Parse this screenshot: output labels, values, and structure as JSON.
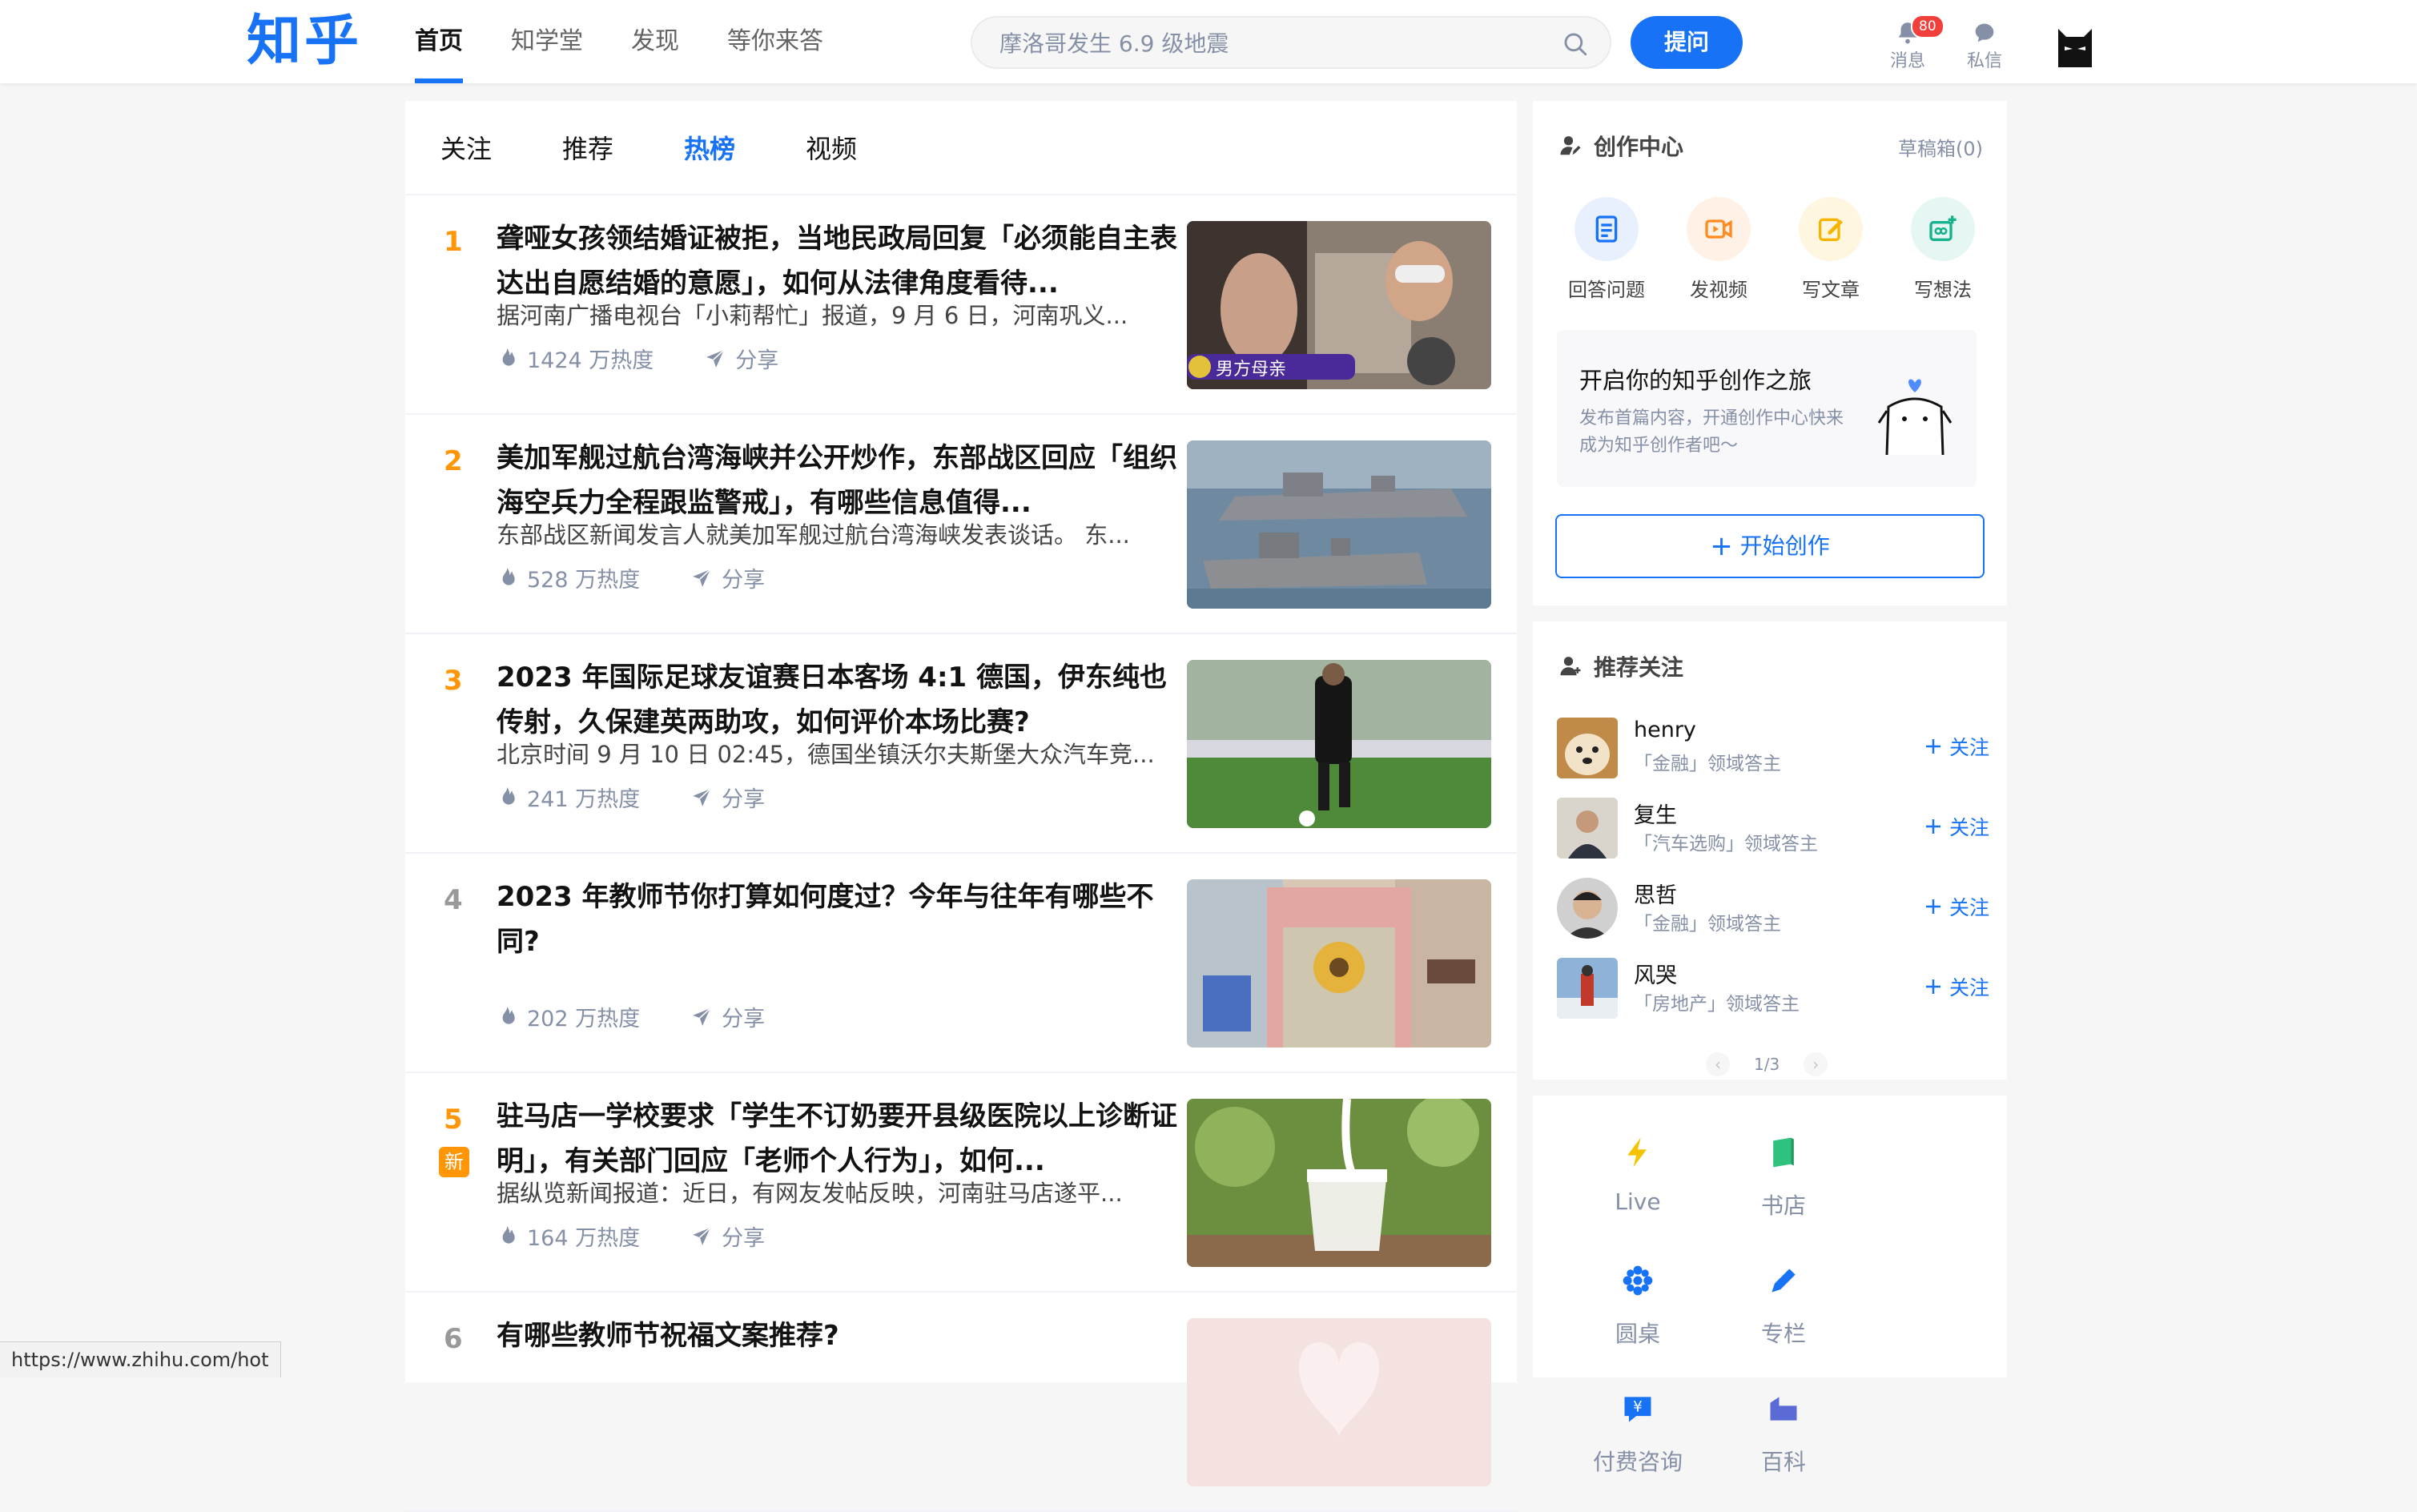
{
  "header": {
    "logo": "知乎",
    "nav": [
      "首页",
      "知学堂",
      "发现",
      "等你来答"
    ],
    "search_placeholder": "摩洛哥发生 6.9 级地震",
    "ask_label": "提问",
    "messages_label": "消息",
    "messages_badge": "80",
    "dm_label": "私信"
  },
  "feed": {
    "tabs": [
      "关注",
      "推荐",
      "热榜",
      "视频"
    ],
    "share_label": "分享",
    "items": [
      {
        "rank": "1",
        "title": "聋哑女孩领结婚证被拒，当地民政局回复「必须能自主表达出自愿结婚的意愿」，如何从法律角度看待...",
        "excerpt": "据河南广播电视台「小莉帮忙」报道，9 月 6 日，河南巩义...",
        "heat": "1424 万热度",
        "thumb_caption": "男方母亲"
      },
      {
        "rank": "2",
        "title": "美加军舰过航台湾海峡并公开炒作，东部战区回应「组织海空兵力全程跟监警戒」，有哪些信息值得...",
        "excerpt": "东部战区新闻发言人就美加军舰过航台湾海峡发表谈话。 东...",
        "heat": "528 万热度"
      },
      {
        "rank": "3",
        "title": "2023 年国际足球友谊赛日本客场 4:1 德国，伊东纯也传射，久保建英两助攻，如何评价本场比赛?",
        "excerpt": "北京时间 9 月 10 日 02:45，德国坐镇沃尔夫斯堡大众汽车竞...",
        "heat": "241 万热度"
      },
      {
        "rank": "4",
        "title": "2023 年教师节你打算如何度过？今年与往年有哪些不同?",
        "excerpt": "",
        "heat": "202 万热度"
      },
      {
        "rank": "5",
        "new_tag": "新",
        "title": "驻马店一学校要求「学生不订奶要开县级医院以上诊断证明」，有关部门回应「老师个人行为」，如何...",
        "excerpt": "据纵览新闻报道：近日，有网友发帖反映，河南驻马店遂平...",
        "heat": "164 万热度"
      },
      {
        "rank": "6",
        "title": "有哪些教师节祝福文案推荐?",
        "excerpt": "",
        "heat": ""
      }
    ]
  },
  "sidebar": {
    "creation": {
      "title": "创作中心",
      "drafts": "草稿箱(0)",
      "actions": [
        "回答问题",
        "发视频",
        "写文章",
        "写想法"
      ],
      "journey_title": "开启你的知乎创作之旅",
      "journey_sub": "发布首篇内容，开通创作中心快来成为知乎创作者吧～",
      "start_label": "开始创作"
    },
    "recommend": {
      "title": "推荐关注",
      "follow_label": "关注",
      "users": [
        {
          "name": "henry",
          "desc": "「金融」领域答主"
        },
        {
          "name": "复生",
          "desc": "「汽车选购」领域答主"
        },
        {
          "name": "思哲",
          "desc": "「金融」领域答主"
        },
        {
          "name": "风哭",
          "desc": "「房地产」领域答主"
        }
      ],
      "pager": "1/3"
    },
    "quick": [
      "Live",
      "书店",
      "圆桌",
      "专栏",
      "付费咨询",
      "百科"
    ]
  },
  "status_url": "https://www.zhihu.com/hot",
  "colors": {
    "brand": "#1772f6",
    "hot_rank": "#ff9607",
    "badge": "#f1403c"
  }
}
